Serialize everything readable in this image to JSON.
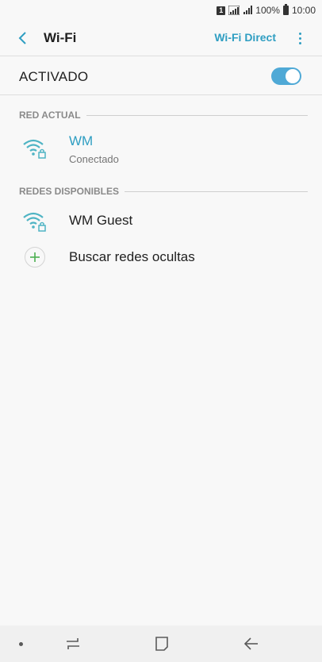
{
  "status_bar": {
    "sim_label": "1",
    "battery_percent": "100%",
    "time": "10:00"
  },
  "header": {
    "title": "Wi-Fi",
    "wifi_direct_label": "Wi-Fi Direct",
    "back_icon": "back-arrow-icon",
    "more_icon": "more-vert-icon"
  },
  "master_switch": {
    "label": "ACTIVADO",
    "state": true,
    "accent_color": "#4fa9d6"
  },
  "current_network": {
    "section_label": "RED ACTUAL",
    "name": "WM",
    "status": "Conectado",
    "name_color": "#2f9ec2",
    "icon": "wifi-lock-icon"
  },
  "available_networks": {
    "section_label": "REDES DISPONIBLES",
    "items": [
      {
        "name": "WM Guest",
        "icon": "wifi-lock-icon"
      }
    ],
    "hidden_networks_label": "Buscar redes ocultas",
    "hidden_icon": "plus-icon"
  },
  "nav_bar": {
    "items": [
      "dot-icon",
      "recents-icon",
      "home-icon",
      "back-icon"
    ]
  }
}
